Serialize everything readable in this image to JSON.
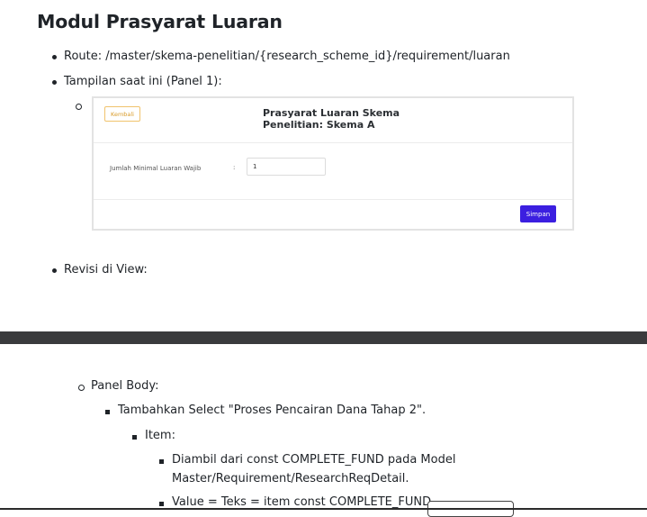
{
  "doc": {
    "title": "Modul Prasyarat Luaran",
    "bullets": [
      "Route: /master/skema-penelitian/{research_scheme_id}/requirement/luaran",
      "Tampilan saat ini (Panel 1):",
      "Revisi di View:"
    ],
    "lower": {
      "panel_body": "Panel Body:",
      "add_select": "Tambahkan Select \"Proses Pencairan Dana Tahap 2\".",
      "item": "Item:",
      "source_line1": "Diambil dari const COMPLETE_FUND pada Model",
      "source_line2": "Master/Requirement/ResearchReqDetail.",
      "value_text": "Value = Teks = item const COMPLETE_FUND."
    }
  },
  "panel": {
    "back_label": "Kembali",
    "title_line1": "Prasyarat Luaran Skema",
    "title_line2": "Penelitian: Skema A",
    "field_label": "Jumlah Minimal Luaran Wajib",
    "field_colon": ":",
    "field_value": "1",
    "save_label": "Simpan"
  },
  "colors": {
    "save_button": "#3b1fe0",
    "back_button_border": "#f0c36d",
    "divider_bar": "#3a3b3d"
  }
}
